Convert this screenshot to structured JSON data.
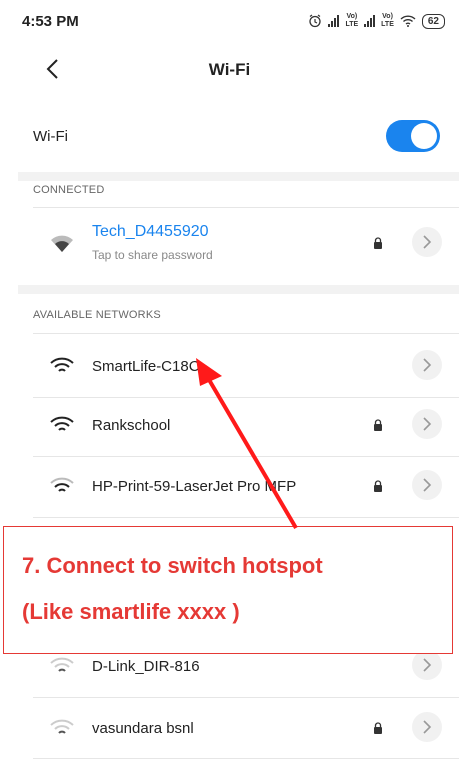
{
  "status_bar": {
    "time": "4:53 PM",
    "lte1": "Vo)\nLTE",
    "lte2": "Vo)\nLTE",
    "battery": "62",
    "icons": [
      "alarm-icon",
      "signal-icon",
      "signal-icon",
      "wifi-icon",
      "battery-icon"
    ]
  },
  "header": {
    "title": "Wi-Fi"
  },
  "wifi_toggle": {
    "label": "Wi-Fi",
    "on": true
  },
  "sections": {
    "connected": "CONNECTED",
    "available": "AVAILABLE NETWORKS"
  },
  "connected_network": {
    "name": "Tech_D4455920",
    "subtitle": "Tap to share password",
    "locked": true
  },
  "networks": [
    {
      "name": "SmartLife-C18C",
      "locked": false,
      "signal": "strong"
    },
    {
      "name": "Rankschool",
      "locked": true,
      "signal": "strong"
    },
    {
      "name": "HP-Print-59-LaserJet Pro MFP",
      "locked": true,
      "signal": "strong"
    },
    {
      "name": "D-Link_DIR-816",
      "locked": false,
      "signal": "weak"
    },
    {
      "name": "vasundara bsnl",
      "locked": true,
      "signal": "weak"
    }
  ],
  "annotation": {
    "line1": "7. Connect to switch hotspot",
    "line2": "(Like smartlife xxxx )"
  },
  "colors": {
    "accent": "#1a84ee",
    "annotation": "#e53935"
  }
}
